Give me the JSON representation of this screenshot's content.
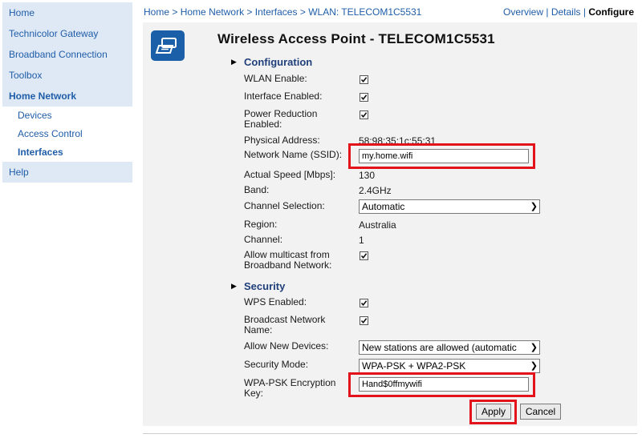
{
  "sidebar": {
    "items": [
      {
        "label": "Home"
      },
      {
        "label": "Technicolor Gateway"
      },
      {
        "label": "Broadband Connection"
      },
      {
        "label": "Toolbox"
      },
      {
        "label": "Home Network"
      }
    ],
    "sub_items": [
      {
        "label": "Devices"
      },
      {
        "label": "Access Control"
      },
      {
        "label": "Interfaces"
      }
    ],
    "help": {
      "label": "Help"
    }
  },
  "breadcrumb": {
    "items": [
      "Home",
      "Home Network",
      "Interfaces",
      "WLAN: TELECOM1C5531"
    ],
    "separator": ">"
  },
  "views": {
    "overview": "Overview",
    "details": "Details",
    "configure": "Configure",
    "separator": "|"
  },
  "page": {
    "title": "Wireless Access Point - TELECOM1C5531",
    "icon": "wireless-access-point-icon"
  },
  "configuration": {
    "heading": "Configuration",
    "wlan_enable": {
      "label": "WLAN Enable:",
      "checked": true
    },
    "interface_enabled": {
      "label": "Interface Enabled:",
      "checked": true
    },
    "power_reduction": {
      "label_line1": "Power Reduction",
      "label_line2": "Enabled:",
      "checked": true
    },
    "physical_address": {
      "label": "Physical Address:",
      "value": "58:98:35:1c:55:31"
    },
    "network_name": {
      "label": "Network Name (SSID):",
      "value": "my.home.wifi"
    },
    "actual_speed": {
      "label": "Actual Speed [Mbps]:",
      "value": "130"
    },
    "band": {
      "label": "Band:",
      "value": "2.4GHz"
    },
    "channel_selection": {
      "label": "Channel Selection:",
      "value": "Automatic"
    },
    "region": {
      "label": "Region:",
      "value": "Australia"
    },
    "channel": {
      "label": "Channel:",
      "value": "1"
    },
    "allow_multicast": {
      "label_line1": "Allow multicast from",
      "label_line2": "Broadband Network:",
      "checked": true
    }
  },
  "security": {
    "heading": "Security",
    "wps_enabled": {
      "label": "WPS Enabled:",
      "checked": true
    },
    "broadcast_name": {
      "label_line1": "Broadcast Network",
      "label_line2": "Name:",
      "checked": true
    },
    "allow_new_devices": {
      "label": "Allow New Devices:",
      "value": "New stations are allowed (automatic"
    },
    "security_mode": {
      "label": "Security Mode:",
      "value": "WPA-PSK + WPA2-PSK"
    },
    "encryption_key": {
      "label_line1": "WPA-PSK Encryption",
      "label_line2": "Key:",
      "value": "Hand$0ffmywifi"
    }
  },
  "buttons": {
    "apply": "Apply",
    "cancel": "Cancel"
  },
  "colors": {
    "link": "#1f5da8",
    "sidebar_bg": "#dfe9f6",
    "panel_bg": "#f2f2f2",
    "highlight": "#e3131b",
    "icon_bg": "#1b5fa8"
  }
}
